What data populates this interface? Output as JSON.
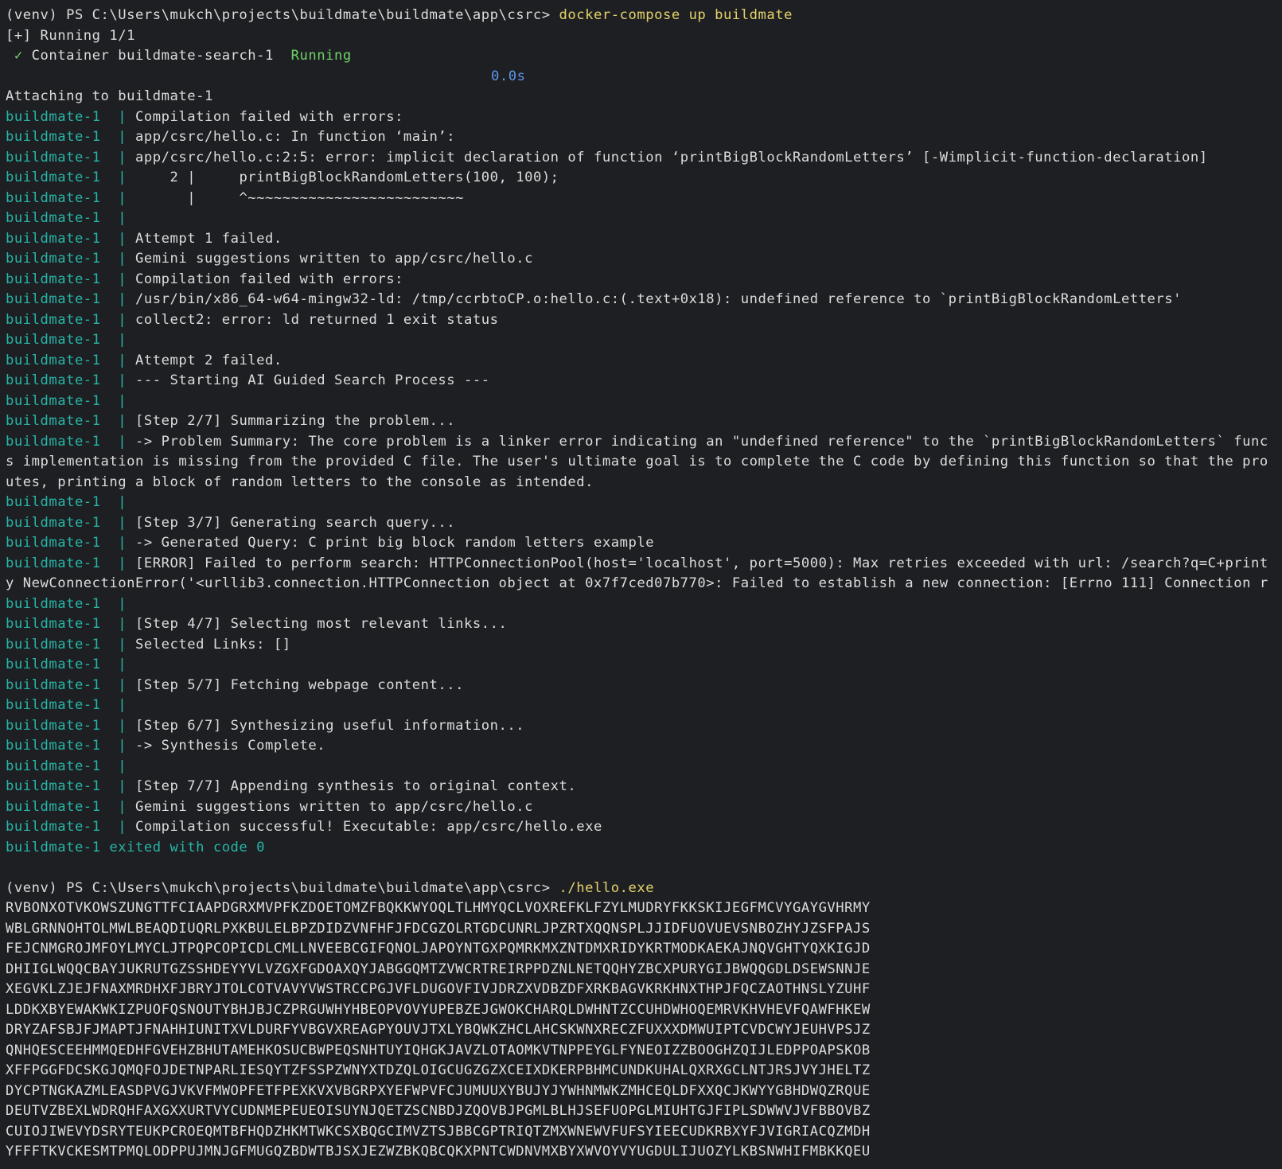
{
  "colors": {
    "background": "#1e1f22",
    "text": "#dcdcdc",
    "container_prefix": "#26b5a8",
    "command": "#e5d36b",
    "success": "#6ed36b",
    "timing": "#5d96ea"
  },
  "icons": {
    "check": "check-icon"
  },
  "lines": [
    {
      "t": "prompt",
      "prompt": "(venv) PS C:\\Users\\mukch\\projects\\buildmate\\buildmate\\app\\csrc> ",
      "cmd": "docker-compose up buildmate"
    },
    {
      "t": "plain",
      "text": "[+] Running 1/1"
    },
    {
      "t": "container",
      "check": "✓",
      "text": " Container buildmate-search-1  ",
      "status": "Running"
    },
    {
      "t": "timing",
      "text": "0.0s"
    },
    {
      "t": "plain",
      "text": "Attaching to buildmate-1"
    },
    {
      "t": "log",
      "prefix": "buildmate-1  | ",
      "text": "Compilation failed with errors:"
    },
    {
      "t": "log",
      "prefix": "buildmate-1  | ",
      "text": "app/csrc/hello.c: In function ‘main’:"
    },
    {
      "t": "log",
      "prefix": "buildmate-1  | ",
      "text": "app/csrc/hello.c:2:5: error: implicit declaration of function ‘printBigBlockRandomLetters’ [-Wimplicit-function-declaration]"
    },
    {
      "t": "log",
      "prefix": "buildmate-1  | ",
      "text": "    2 |     printBigBlockRandomLetters(100, 100);"
    },
    {
      "t": "log",
      "prefix": "buildmate-1  | ",
      "text": "      |     ^~~~~~~~~~~~~~~~~~~~~~~~~~"
    },
    {
      "t": "log",
      "prefix": "buildmate-1  | ",
      "text": ""
    },
    {
      "t": "log",
      "prefix": "buildmate-1  | ",
      "text": "Attempt 1 failed."
    },
    {
      "t": "log",
      "prefix": "buildmate-1  | ",
      "text": "Gemini suggestions written to app/csrc/hello.c"
    },
    {
      "t": "log",
      "prefix": "buildmate-1  | ",
      "text": "Compilation failed with errors:"
    },
    {
      "t": "log",
      "prefix": "buildmate-1  | ",
      "text": "/usr/bin/x86_64-w64-mingw32-ld: /tmp/ccrbtoCP.o:hello.c:(.text+0x18): undefined reference to `printBigBlockRandomLetters'"
    },
    {
      "t": "log",
      "prefix": "buildmate-1  | ",
      "text": "collect2: error: ld returned 1 exit status"
    },
    {
      "t": "log",
      "prefix": "buildmate-1  | ",
      "text": ""
    },
    {
      "t": "log",
      "prefix": "buildmate-1  | ",
      "text": "Attempt 2 failed."
    },
    {
      "t": "log",
      "prefix": "buildmate-1  | ",
      "text": "--- Starting AI Guided Search Process ---"
    },
    {
      "t": "log",
      "prefix": "buildmate-1  | ",
      "text": ""
    },
    {
      "t": "log",
      "prefix": "buildmate-1  | ",
      "text": "[Step 2/7] Summarizing the problem..."
    },
    {
      "t": "log",
      "prefix": "buildmate-1  | ",
      "text": "-> Problem Summary: The core problem is a linker error indicating an \"undefined reference\" to the `printBigBlockRandomLetters` func"
    },
    {
      "t": "plain",
      "text": "s implementation is missing from the provided C file. The user's ultimate goal is to complete the C code by defining this function so that the pro"
    },
    {
      "t": "plain",
      "text": "utes, printing a block of random letters to the console as intended."
    },
    {
      "t": "log",
      "prefix": "buildmate-1  | ",
      "text": ""
    },
    {
      "t": "log",
      "prefix": "buildmate-1  | ",
      "text": "[Step 3/7] Generating search query..."
    },
    {
      "t": "log",
      "prefix": "buildmate-1  | ",
      "text": "-> Generated Query: C print big block random letters example"
    },
    {
      "t": "log",
      "prefix": "buildmate-1  | ",
      "text": "[ERROR] Failed to perform search: HTTPConnectionPool(host='localhost', port=5000): Max retries exceeded with url: /search?q=C+print"
    },
    {
      "t": "plain",
      "text": "y NewConnectionError('<urllib3.connection.HTTPConnection object at 0x7f7ced07b770>: Failed to establish a new connection: [Errno 111] Connection r"
    },
    {
      "t": "log",
      "prefix": "buildmate-1  | ",
      "text": ""
    },
    {
      "t": "log",
      "prefix": "buildmate-1  | ",
      "text": "[Step 4/7] Selecting most relevant links..."
    },
    {
      "t": "log",
      "prefix": "buildmate-1  | ",
      "text": "Selected Links: []"
    },
    {
      "t": "log",
      "prefix": "buildmate-1  | ",
      "text": ""
    },
    {
      "t": "log",
      "prefix": "buildmate-1  | ",
      "text": "[Step 5/7] Fetching webpage content..."
    },
    {
      "t": "log",
      "prefix": "buildmate-1  | ",
      "text": ""
    },
    {
      "t": "log",
      "prefix": "buildmate-1  | ",
      "text": "[Step 6/7] Synthesizing useful information..."
    },
    {
      "t": "log",
      "prefix": "buildmate-1  | ",
      "text": "-> Synthesis Complete."
    },
    {
      "t": "log",
      "prefix": "buildmate-1  | ",
      "text": ""
    },
    {
      "t": "log",
      "prefix": "buildmate-1  | ",
      "text": "[Step 7/7] Appending synthesis to original context."
    },
    {
      "t": "log",
      "prefix": "buildmate-1  | ",
      "text": "Gemini suggestions written to app/csrc/hello.c"
    },
    {
      "t": "log",
      "prefix": "buildmate-1  | ",
      "text": "Compilation successful! Executable: app/csrc/hello.exe"
    },
    {
      "t": "exit",
      "text": "buildmate-1 exited with code 0"
    },
    {
      "t": "plain",
      "text": ""
    },
    {
      "t": "prompt",
      "prompt": "(venv) PS C:\\Users\\mukch\\projects\\buildmate\\buildmate\\app\\csrc> ",
      "cmd": "./hello.exe"
    },
    {
      "t": "plain",
      "text": "RVBONXOTVKOWSZUNGTTFCIAAPDGRXMVPFKZDOETOMZFBQKKWYOQLTLHMYQCLVOXREFKLFZYLMUDRYFKKSKIJEGFMCVYGAYGVHRMY"
    },
    {
      "t": "plain",
      "text": "WBLGRNNOHTOLMWLBEAQDIUQRLPXKBULELBPZDIDZVNFHFJFDCGZOLRTGDCUNRLJPZRTXQQNSPLJJIDFUOVUEVSNBOZHYJZSFPAJS"
    },
    {
      "t": "plain",
      "text": "FEJCNMGROJMFOYLMYCLJTPQPCOPICDLCMLLNVEEBCGIFQNOLJAPOYNTGXPQMRKMXZNTDMXRIDYKRTMODKAEKAJNQVGHTYQXKIGJD"
    },
    {
      "t": "plain",
      "text": "DHIIGLWQQCBAYJUKRUTGZSSHDEYYVLVZGXFGDOAXQYJABGGQMTZVWCRTREIRPPDZNLNETQQHYZBCXPURYGIJBWQQGDLDSEWSNNJE"
    },
    {
      "t": "plain",
      "text": "XEGVKLZJEJFNAXMRDHXFJBRYJTOLCOTVAVYVWSTRCCPGJVFLDUGOVFIVJDRZXVDBZDFXRKBAGVKRKHNXTHPJFQCZAOTHNSLYZUHF"
    },
    {
      "t": "plain",
      "text": "LDDKXBYEWAKWKIZPUOFQSNOUTYBHJBJCZPRGUWHYHBEOPVOVYUPEBZEJGWOKCHARQLDWHNTZCCUHDWHOQEMRVKHVHEVFQAWFHKEW"
    },
    {
      "t": "plain",
      "text": "DRYZAFSBJFJMAPTJFNAHHIUNITXVLDURFYVBGVXREAGPYOUVJTXLYBQWKZHCLAHCSKWNXRECZFUXXXDMWUIPTCVDCWYJEUHVPSJZ"
    },
    {
      "t": "plain",
      "text": "QNHQESCEEHMMQEDHFGVEHZBHUTAMEHKOSUCBWPEQSNHTUYIQHGKJAVZLOTAOMKVTNPPEYGLFYNEOIZZBOOGHZQIJLEDPPOAPSKOB"
    },
    {
      "t": "plain",
      "text": "XFFPGGFDCSKGJQMQFOJDETNPARLIESQYTZFSSPZWNYXTDZQLOIGCUGZGZXCEIXDKERPBHMCUNDKUHALQXRXGCLNTJRSJVYJHELTZ"
    },
    {
      "t": "plain",
      "text": "DYCPTNGKAZMLEASDPVGJVKVFMWOPFETFPEXKVXVBGRPXYEFWPVFCJUMUUXYBUJYJYWHNMWKZMHCEQLDFXXQCJKWYYGBHDWQZRQUE"
    },
    {
      "t": "plain",
      "text": "DEUTVZBEXLWDRQHFAXGXXURTVYCUDNMEPEUEOISUYNJQETZSCNBDJZQOVBJPGMLBLHJSEFUOPGLMIUHTGJFIPLSDWWVJVFBBOVBZ"
    },
    {
      "t": "plain",
      "text": "CUIOJIWEVYDSRYTEUKPCROEQMTBFHQDZHKMTWKCSXBQGCIMVZTSJBBCGPTRIQTZMXWNEWVFUFSYIEECUDKRBXYFJVIGRIACQZMDH"
    },
    {
      "t": "plain",
      "text": "YFFFTKVCKESMTPMQLODPPUJMNJGFMUGQZBDWTBJSXJEZWZBKQBCQKXPNTCWDNVMXBYXWVOYVYUGDULIJUOZYLKBSNWHIFMBKKQEU"
    }
  ]
}
